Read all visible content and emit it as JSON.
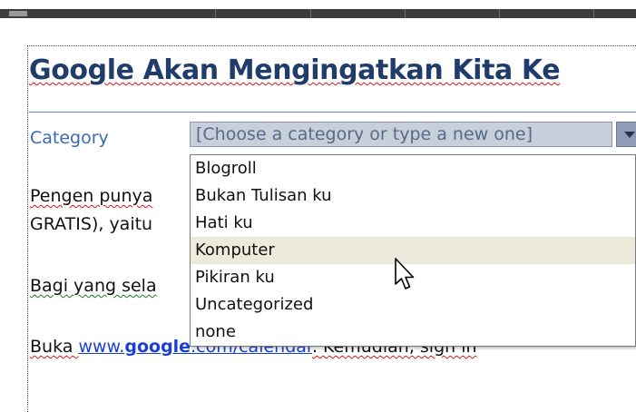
{
  "document": {
    "title": "Google Akan Mengingatkan Kita Ke",
    "category": {
      "label": "Category",
      "placeholder": "[Choose a category or type a new one]"
    },
    "paragraphs": {
      "p1_line1": "Pengen punya",
      "p1_line2": "GRATIS), yaitu",
      "p2": "Bagi yang sela",
      "p3_prefix": "Buka ",
      "p3_link_a": "www.",
      "p3_link_b": "google",
      "p3_link_c": ".com/calendar",
      "p3_suffix": ". Kemudian, sign in"
    }
  },
  "dropdown": {
    "items": [
      {
        "label": "Blogroll"
      },
      {
        "label": "Bukan Tulisan ku"
      },
      {
        "label": "Hati ku"
      },
      {
        "label": "Komputer",
        "hovered": true
      },
      {
        "label": "Pikiran ku"
      },
      {
        "label": "Uncategorized"
      },
      {
        "label": "none"
      }
    ]
  },
  "icons": {
    "dropdown_arrow": "chevron-down-icon",
    "cursor": "mouse-pointer-icon"
  },
  "colors": {
    "title": "#1f3c6a",
    "category_label": "#3e68b0",
    "combo_bg": "#c7cfdb",
    "hover_bg": "#edeadc",
    "link": "#1a3fd6"
  }
}
